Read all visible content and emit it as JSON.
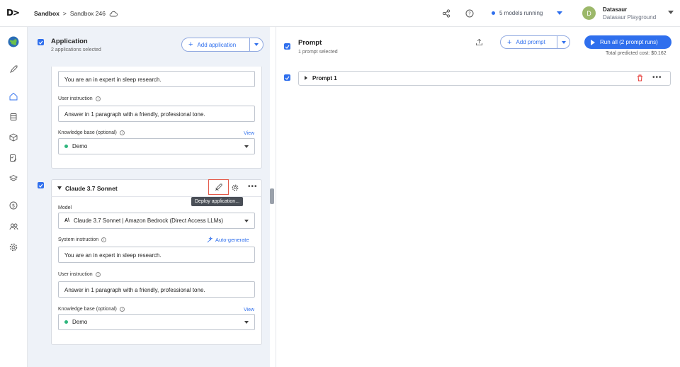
{
  "topbar": {
    "logo": "D>",
    "breadcrumb": [
      "Sandbox",
      ">",
      "Sandbox 246"
    ],
    "models_running": "5 models running",
    "user_initial": "D",
    "user_name": "Datasaur",
    "workspace": "Datasaur Playground"
  },
  "application": {
    "title": "Application",
    "subtitle": "2 applications selected",
    "add_button": "Add application",
    "first_card": {
      "system_instruction_value": "You are an in expert in sleep research.",
      "user_instruction_label": "User instruction",
      "user_instruction_value": "Answer in 1 paragraph with a friendly, professional tone.",
      "kb_label": "Knowledge base (optional)",
      "kb_link": "View",
      "kb_value": "Demo"
    },
    "second_card": {
      "name": "Claude 3.7 Sonnet",
      "tooltip": "Deploy application...",
      "model_label": "Model",
      "model_value": "Claude 3.7 Sonnet | Amazon Bedrock (Direct Access LLMs)",
      "model_prefix": "A\\",
      "system_instruction_label": "System instruction",
      "auto_generate": "Auto-generate",
      "system_instruction_value": "You are an in expert in sleep research.",
      "user_instruction_label": "User instruction",
      "user_instruction_value": "Answer in 1 paragraph with a friendly, professional tone.",
      "kb_label": "Knowledge base (optional)",
      "kb_link": "View",
      "kb_value": "Demo"
    }
  },
  "prompt": {
    "title": "Prompt",
    "subtitle": "1 prompt selected",
    "add_button": "Add prompt",
    "run_button": "Run all (2 prompt runs)",
    "cost": "Total predicted cost: $0.162",
    "items": [
      {
        "label": "Prompt 1"
      }
    ]
  },
  "colors": {
    "accent": "#2f6fed",
    "panel_bg": "#eef2f8",
    "delete": "#e53935",
    "tooltip_bg": "#4a4f57"
  }
}
